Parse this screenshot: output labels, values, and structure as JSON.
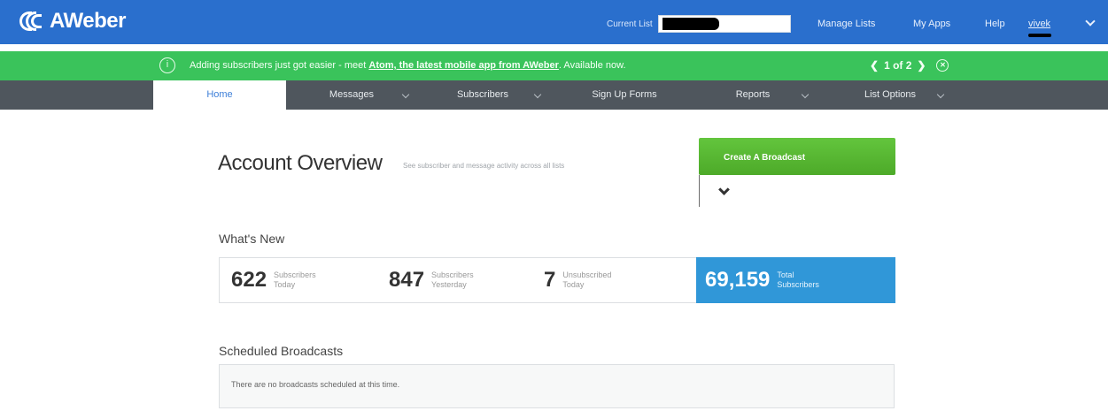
{
  "header": {
    "logo_text": "AWeber",
    "current_list_label": "Current List",
    "current_list_value": "",
    "nav": [
      "Manage Lists",
      "My Apps",
      "Help"
    ],
    "user": "vivek"
  },
  "announcement": {
    "text_before": "Adding subscribers just got easier - meet ",
    "link": "Atom, the latest mobile app from AWeber",
    "text_after": ". Available now.",
    "pager": "1 of 2"
  },
  "mainnav": {
    "items": [
      "Home",
      "Messages",
      "Subscribers",
      "Sign Up Forms",
      "Reports",
      "List Options"
    ]
  },
  "overview": {
    "title": "Account Overview",
    "subtitle": "See subscriber and message activity across all lists",
    "broadcast_button": "Create A Broadcast"
  },
  "whats_new": {
    "title": "What's New",
    "stats": [
      {
        "value": "622",
        "label1": "Subscribers",
        "label2": "Today"
      },
      {
        "value": "847",
        "label1": "Subscribers",
        "label2": "Yesterday"
      },
      {
        "value": "7",
        "label1": "Unsubscribed",
        "label2": "Today"
      },
      {
        "value": "69,159",
        "label1": "Total",
        "label2": "Subscribers"
      }
    ]
  },
  "scheduled": {
    "title": "Scheduled Broadcasts",
    "empty_text": "There are no broadcasts scheduled at this time."
  },
  "colors": {
    "topbar": "#2a6fcd",
    "announce": "#3ac35b",
    "nav": "#4f565d",
    "broadcast": "#58b833",
    "total": "#3097d8"
  }
}
